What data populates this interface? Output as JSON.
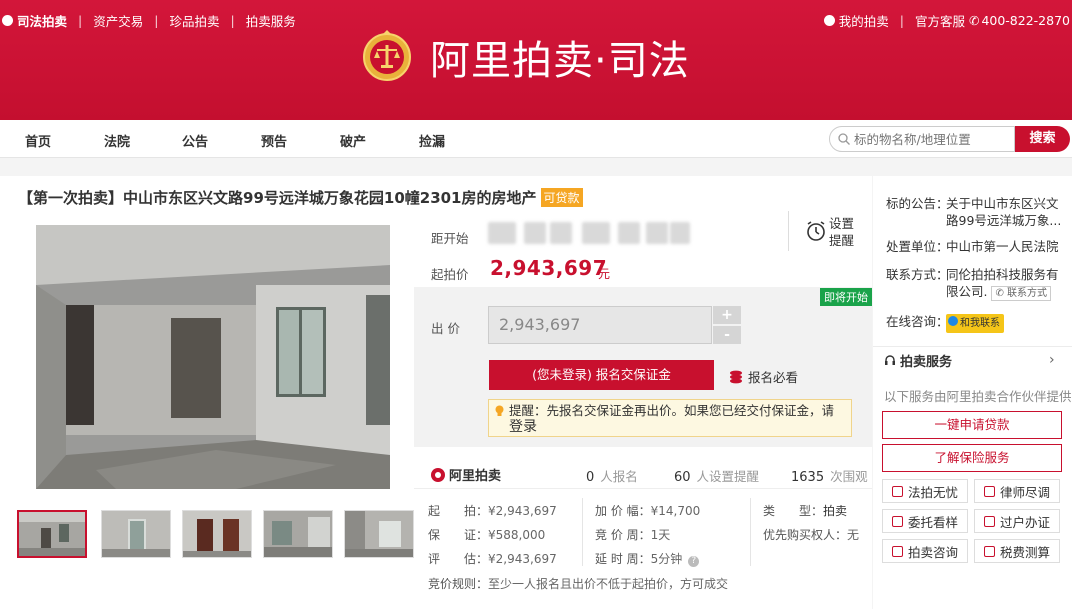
{
  "header": {
    "brand": "司法拍卖",
    "links": [
      "资产交易",
      "珍品拍卖",
      "拍卖服务"
    ],
    "my_auction": "我的拍卖",
    "support": "官方客服",
    "phone": "400-822-2870",
    "logo_text": "阿里拍卖·司法"
  },
  "nav": {
    "items": [
      "首页",
      "法院",
      "公告",
      "预告",
      "破产",
      "捡漏"
    ],
    "search_placeholder": "标的物名称/地理位置",
    "search_button": "搜索"
  },
  "listing": {
    "title": "【第一次拍卖】中山市东区兴文路99号远洋城万象花园10幢2301房的房地产",
    "loan_badge": "可贷款",
    "countdown_label": "距开始",
    "start_price_label": "起拍价",
    "start_price": "2,943,697",
    "price_unit": "元",
    "remind_label": "设置提醒",
    "status_badge": "即将开始",
    "bid_label": "出 价",
    "bid_value": "2,943,697",
    "plus": "+",
    "minus": "-",
    "signup_button": "(您未登录) 报名交保证金",
    "must_read": "报名必看",
    "notice_text": "提醒：先报名交保证金再出价。如果您已经交付保证金，请",
    "notice_login": "登录"
  },
  "stats": {
    "brand": "阿里拍卖",
    "signups": "0",
    "signups_label": "人报名",
    "reminders": "60",
    "reminders_label": "人设置提醒",
    "views": "1635",
    "views_label": "次围观"
  },
  "details": {
    "start_k": "起　　拍：",
    "start_v": "¥2,943,697",
    "deposit_k": "保　　证：",
    "deposit_v": "¥588,000",
    "appraisal_k": "评　　估：",
    "appraisal_v": "¥2,943,697",
    "increment_k": "加 价 幅：",
    "increment_v": "¥14,700",
    "cycle_k": "竞 价 周：",
    "cycle_v": "1天",
    "extend_k": "延 时 周：",
    "extend_v": "5分钟",
    "type_k": "类　　型：",
    "type_v": "拍卖",
    "priority_k": "优先购买权人：",
    "priority_v": "无",
    "rule_k": "竞价规则：",
    "rule_v": "至少一人报名且出价不低于起拍价，方可成交"
  },
  "sidebar": {
    "notice_k": "标的公告：",
    "notice_v1": "关于中山市东区兴文",
    "notice_v2": "路99号远洋城万象...",
    "court_k": "处置单位：",
    "court_v": "中山市第一人民法院",
    "contact_k": "联系方式：",
    "contact_v1": "同伦拍拍科技服务有",
    "contact_v2": "限公司.",
    "contact_btn": "联系方式",
    "chat_k": "在线咨询：",
    "chat_btn": "和我联系",
    "service_title": "拍卖服务",
    "service_sub": "以下服务由阿里拍卖合作伙伴提供",
    "loan_btn": "一键申请贷款",
    "insurance_btn": "了解保险服务",
    "cells": [
      "法拍无忧",
      "律师尽调",
      "委托看样",
      "过户办证",
      "拍卖咨询",
      "税费测算"
    ]
  },
  "colors": {
    "brand_red": "#c8102e",
    "green_badge": "#1aa34a",
    "orange_badge": "#f5a623"
  }
}
